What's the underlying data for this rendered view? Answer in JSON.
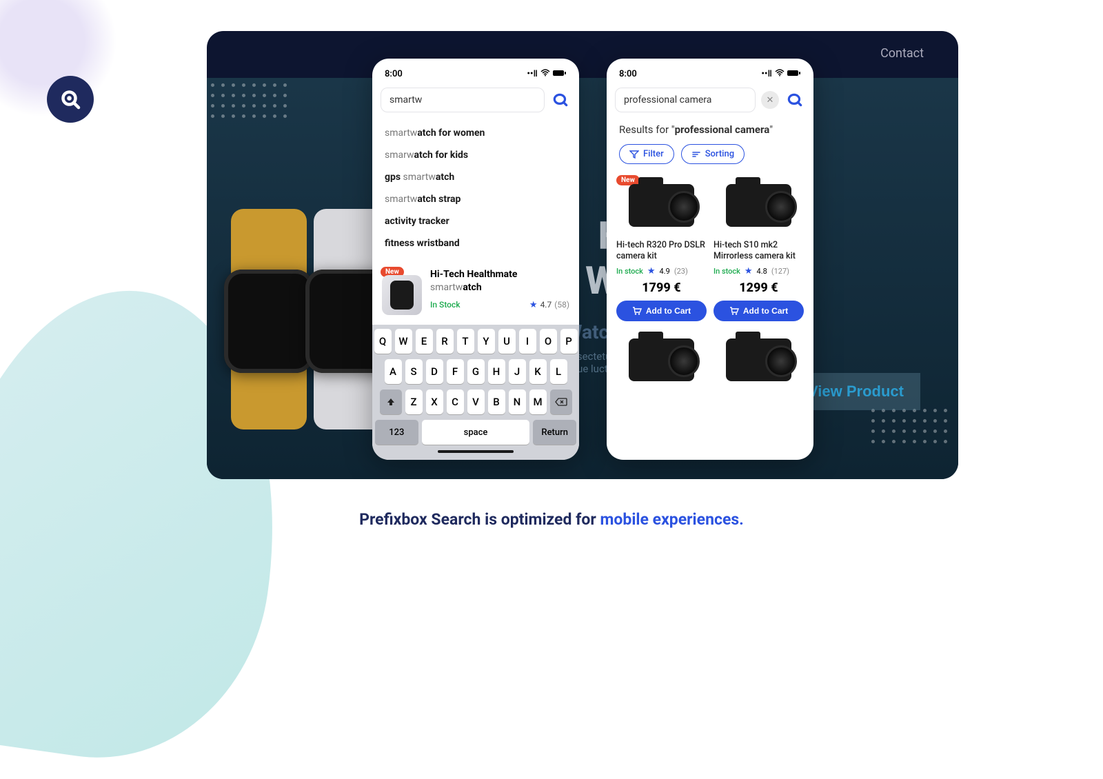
{
  "nav": {
    "contact": "Contact"
  },
  "hero": {
    "title_line1": "Health",
    "title_line2": "Wrist.",
    "subtitle": "Watch Series",
    "view_product": "View Product"
  },
  "status": {
    "time": "8:00"
  },
  "phone1": {
    "search_value": "smartw",
    "suggestions": [
      {
        "light": "smartw",
        "bold": "atch for women"
      },
      {
        "light": "smarw",
        "bold": "atch for kids"
      },
      {
        "light_pre": "gps ",
        "light": "smartw",
        "bold": "atch"
      },
      {
        "light": "smartw",
        "bold": "atch strap"
      },
      {
        "light": "",
        "bold": "activity tracker"
      },
      {
        "light": "",
        "bold": "fitness wristband"
      }
    ],
    "product": {
      "badge": "New",
      "title_bold": "Hi-Tech Healthmate",
      "title_light": " smartw",
      "title_bold2": "atch",
      "stock": "In Stock",
      "rating": "4.7",
      "count": "(58)"
    },
    "keyboard": {
      "row1": [
        "Q",
        "W",
        "E",
        "R",
        "T",
        "Y",
        "U",
        "I",
        "O",
        "P"
      ],
      "row2": [
        "A",
        "S",
        "D",
        "F",
        "G",
        "H",
        "J",
        "K",
        "L"
      ],
      "row3": [
        "Z",
        "X",
        "C",
        "V",
        "B",
        "N",
        "M"
      ],
      "num": "123",
      "space": "space",
      "return": "Return"
    }
  },
  "phone2": {
    "search_value": "professional camera",
    "results_prefix": "Results for \"",
    "results_suffix": "\"",
    "filter": "Filter",
    "sorting": "Sorting",
    "products": [
      {
        "badge": "New",
        "name": "Hi-tech R320 Pro DSLR camera kit",
        "stock": "In stock",
        "rating": "4.9",
        "count": "(23)",
        "price": "1799 €",
        "cart": "Add to Cart"
      },
      {
        "name": "Hi-tech S10 mk2 Mirrorless camera kit",
        "stock": "In stock",
        "rating": "4.8",
        "count": "(127)",
        "price": "1299 €",
        "cart": "Add to Cart"
      }
    ]
  },
  "caption": {
    "text": "Prefixbox Search is optimized for ",
    "highlight": "mobile experiences."
  }
}
